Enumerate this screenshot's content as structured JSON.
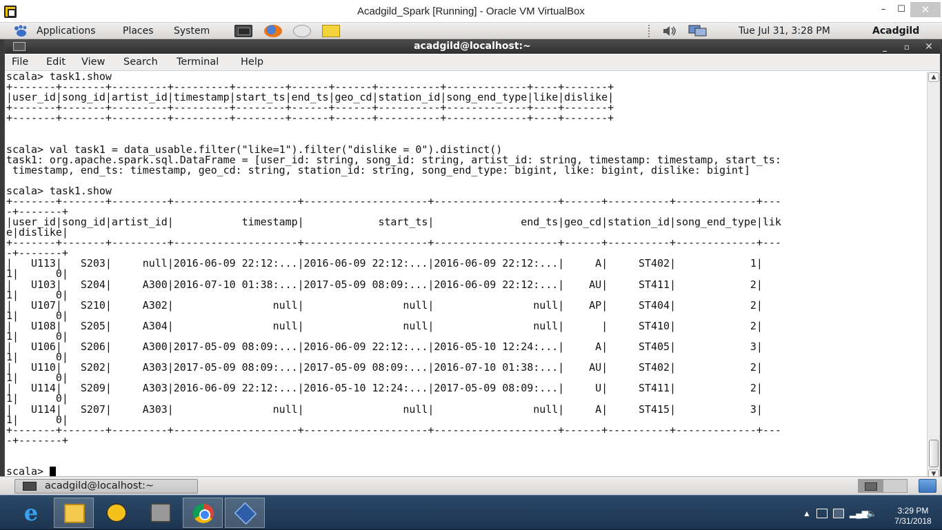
{
  "vbox": {
    "title": "Acadgild_Spark [Running] - Oracle VM VirtualBox",
    "minimize": "–",
    "maximize": "☐",
    "close": "✕"
  },
  "gnome_panel": {
    "menus": [
      "Applications",
      "Places",
      "System"
    ],
    "clock": "Tue Jul 31,  3:28 PM",
    "user": "Acadgild"
  },
  "terminal": {
    "title": "acadgild@localhost:~",
    "menu": [
      "File",
      "Edit",
      "View",
      "Search",
      "Terminal",
      "Help"
    ],
    "lines": [
      "scala> task1.show",
      "+-------+-------+---------+---------+--------+------+------+----------+-------------+----+-------+",
      "|user_id|song_id|artist_id|timestamp|start_ts|end_ts|geo_cd|station_id|song_end_type|like|dislike|",
      "+-------+-------+---------+---------+--------+------+------+----------+-------------+----+-------+",
      "+-------+-------+---------+---------+--------+------+------+----------+-------------+----+-------+",
      "",
      "",
      "scala> val task1 = data_usable.filter(\"like=1\").filter(\"dislike = 0\").distinct()",
      "task1: org.apache.spark.sql.DataFrame = [user_id: string, song_id: string, artist_id: string, timestamp: timestamp, start_ts:",
      " timestamp, end_ts: timestamp, geo_cd: string, station_id: string, song_end_type: bigint, like: bigint, dislike: bigint]",
      "",
      "scala> task1.show",
      "+-------+-------+---------+--------------------+--------------------+--------------------+------+----------+-------------+---",
      "-+-------+",
      "|user_id|song_id|artist_id|           timestamp|            start_ts|              end_ts|geo_cd|station_id|song_end_type|lik",
      "e|dislike|",
      "+-------+-------+---------+--------------------+--------------------+--------------------+------+----------+-------------+---",
      "-+-------+",
      "|   U113|   S203|     null|2016-06-09 22:12:...|2016-06-09 22:12:...|2016-06-09 22:12:...|     A|     ST402|            1|",
      "1|      0|",
      "|   U103|   S204|     A300|2016-07-10 01:38:...|2017-05-09 08:09:...|2016-06-09 22:12:...|    AU|     ST411|            2|",
      "1|      0|",
      "|   U107|   S210|     A302|                null|                null|                null|    AP|     ST404|            2|",
      "1|      0|",
      "|   U108|   S205|     A304|                null|                null|                null|      |     ST410|            2|",
      "1|      0|",
      "|   U106|   S206|     A300|2017-05-09 08:09:...|2016-06-09 22:12:...|2016-05-10 12:24:...|     A|     ST405|            3|",
      "1|      0|",
      "|   U110|   S202|     A303|2017-05-09 08:09:...|2017-05-09 08:09:...|2016-07-10 01:38:...|    AU|     ST402|            2|",
      "1|      0|",
      "|   U114|   S209|     A303|2016-06-09 22:12:...|2016-05-10 12:24:...|2017-05-09 08:09:...|     U|     ST411|            2|",
      "1|      0|",
      "|   U114|   S207|     A303|                null|                null|                null|     A|     ST415|            3|",
      "1|      0|",
      "+-------+-------+---------+--------------------+--------------------+--------------------+------+----------+-------------+---",
      "-+-------+",
      "",
      "",
      "scala> "
    ]
  },
  "bottom_panel": {
    "task_label": "acadgild@localhost:~"
  },
  "host_taskbar": {
    "time": "3:29 PM",
    "date": "7/31/2018"
  },
  "icons": {
    "foot": "gnome-foot-icon",
    "terminal": "terminal-icon",
    "firefox": "firefox-icon",
    "mail": "mail-icon",
    "notes": "notes-icon",
    "volume": "volume-icon",
    "network": "network-icon"
  }
}
